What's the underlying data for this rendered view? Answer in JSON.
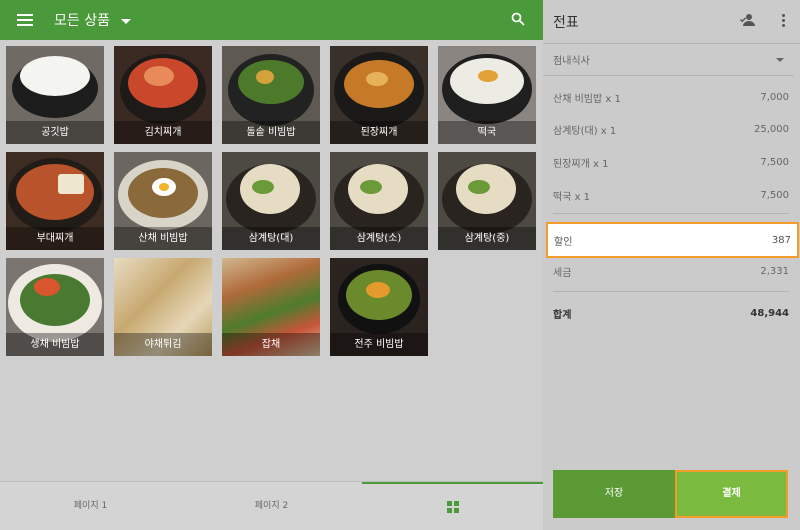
{
  "header": {
    "title": "모든 상품"
  },
  "products": [
    {
      "name": "공깃밥"
    },
    {
      "name": "김치찌개"
    },
    {
      "name": "돌솥 비빔밥"
    },
    {
      "name": "된장찌개"
    },
    {
      "name": "떡국"
    },
    {
      "name": "부대찌개"
    },
    {
      "name": "산채 비빔밥"
    },
    {
      "name": "삼계탕(대)"
    },
    {
      "name": "삼계탕(소)"
    },
    {
      "name": "삼계탕(중)"
    },
    {
      "name": "생채 비빔밥"
    },
    {
      "name": "야채튀김"
    },
    {
      "name": "잡채"
    },
    {
      "name": "전주 비빔밥"
    }
  ],
  "bottom_nav": {
    "tabs": [
      {
        "label": "페이지 1"
      },
      {
        "label": "페이지 2"
      }
    ]
  },
  "receipt": {
    "title": "전표",
    "dining_option": "점내식사",
    "items": [
      {
        "name": "산채 비빔밥 x 1",
        "price": "7,000"
      },
      {
        "name": "삼계탕(대) x 1",
        "price": "25,000"
      },
      {
        "name": "된장찌개 x 1",
        "price": "7,500"
      },
      {
        "name": "떡국 x 1",
        "price": "7,500"
      }
    ],
    "discount": {
      "label": "할인",
      "value": "387"
    },
    "tax": {
      "label": "세금",
      "value": "2,331"
    },
    "total": {
      "label": "합계",
      "value": "48,944"
    },
    "save_label": "저장",
    "pay_label": "결제"
  },
  "colors": {
    "accent": "#4a9a3c",
    "highlight": "#f39c2b",
    "pay": "#79ba3f"
  }
}
